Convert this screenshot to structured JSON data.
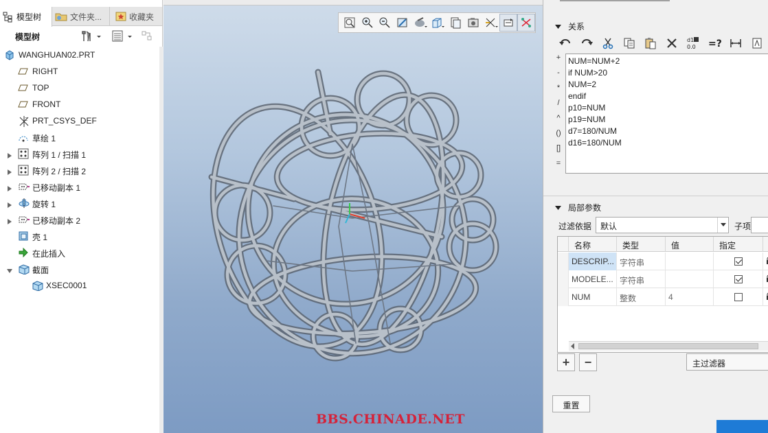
{
  "left_panel": {
    "tabs": [
      {
        "label": "模型树",
        "icon": "tree-icon",
        "active": true
      },
      {
        "label": "文件夹...",
        "icon": "folder-icon",
        "active": false
      },
      {
        "label": "收藏夹",
        "icon": "favorites-icon",
        "active": false
      }
    ],
    "tree_title": "模型树",
    "tree_items": [
      {
        "label": "WANGHUAN02.PRT",
        "icon": "part-icon",
        "level": 0,
        "expandable": false
      },
      {
        "label": "RIGHT",
        "icon": "datum-plane-icon",
        "level": 1,
        "expandable": false
      },
      {
        "label": "TOP",
        "icon": "datum-plane-icon",
        "level": 1,
        "expandable": false
      },
      {
        "label": "FRONT",
        "icon": "datum-plane-icon",
        "level": 1,
        "expandable": false
      },
      {
        "label": "PRT_CSYS_DEF",
        "icon": "csys-icon",
        "level": 1,
        "expandable": false
      },
      {
        "label": "草绘 1",
        "icon": "sketch-icon",
        "level": 1,
        "expandable": false
      },
      {
        "label": "阵列 1 / 扫描 1",
        "icon": "pattern-icon",
        "level": 1,
        "expandable": true
      },
      {
        "label": "阵列 2 / 扫描 2",
        "icon": "pattern-icon",
        "level": 1,
        "expandable": true
      },
      {
        "label": "已移动副本 1",
        "icon": "moved-copy-icon",
        "level": 1,
        "expandable": true
      },
      {
        "label": "旋转 1",
        "icon": "revolve-icon",
        "level": 1,
        "expandable": true
      },
      {
        "label": "已移动副本 2",
        "icon": "moved-copy-icon",
        "level": 1,
        "expandable": true
      },
      {
        "label": "壳 1",
        "icon": "shell-icon",
        "level": 1,
        "expandable": false
      },
      {
        "label": "在此插入",
        "icon": "insert-here-icon",
        "level": 1,
        "expandable": false
      },
      {
        "label": "截面",
        "icon": "section-icon",
        "level": 1,
        "expandable": true,
        "expanded": true
      },
      {
        "label": "XSEC0001",
        "icon": "section-icon",
        "level": 2,
        "expandable": false
      }
    ]
  },
  "viewport": {
    "toolbar_icons": [
      "refit-icon",
      "zoom-in-icon",
      "zoom-out-icon",
      "repaint-icon",
      "display-style-icon",
      "saved-views-icon",
      "view-manager-icon",
      "perspective-icon",
      "datum-display-icon",
      "spin-center-icon",
      "annotation-display-icon"
    ],
    "watermark": "BBS.CHINADE.NET"
  },
  "relations_dialog": {
    "relations_header": "关系",
    "relations_toolbar_icons": [
      "undo-icon",
      "redo-icon",
      "cut-icon",
      "copy-icon",
      "paste-icon",
      "delete-icon",
      "display-values-icon",
      "evaluate-icon",
      "dimension-icon",
      "sort-icon"
    ],
    "operators": [
      "+",
      "-",
      "*",
      "/",
      "^",
      "()",
      "[]",
      "="
    ],
    "relations_lines": [
      "NUM=NUM+2",
      "if NUM>20",
      "NUM=2",
      "endif",
      "p10=NUM",
      "p19=NUM",
      "d7=180/NUM",
      "d16=180/NUM"
    ],
    "local_params_header": "局部参数",
    "filter_label": "过滤依据",
    "filter_value": "默认",
    "sub_label": "子项",
    "columns": [
      "名称",
      "类型",
      "值",
      "指定"
    ],
    "rows": [
      {
        "name": "DESCRIP...",
        "type": "字符串",
        "value": "",
        "designate": true,
        "selected": true
      },
      {
        "name": "MODELE...",
        "type": "字符串",
        "value": "",
        "designate": true,
        "selected": false
      },
      {
        "name": "NUM",
        "type": "整数",
        "value": "4",
        "designate": false,
        "selected": false
      }
    ],
    "add_label": "+",
    "remove_label": "−",
    "master_filter_label": "主过滤器",
    "reset_label": "重置"
  }
}
